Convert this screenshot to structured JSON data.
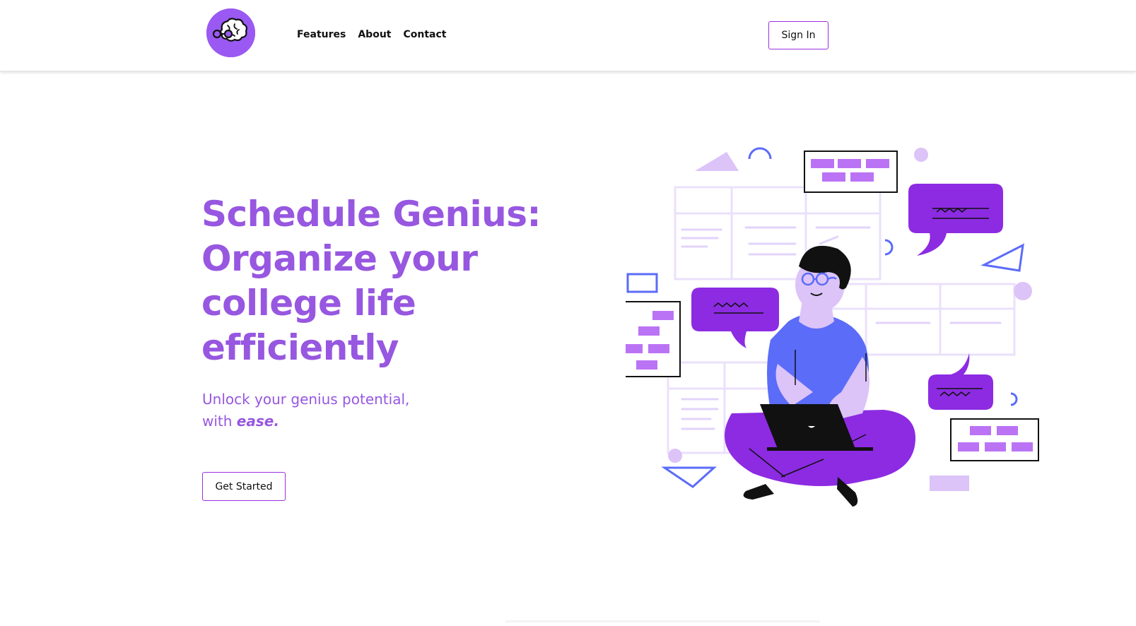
{
  "header": {
    "logo_icon": "brain-with-glasses-logo",
    "nav": [
      {
        "label": "Features"
      },
      {
        "label": "About"
      },
      {
        "label": "Contact"
      }
    ],
    "signin_label": "Sign In"
  },
  "hero": {
    "title_lines": [
      "Schedule Genius:",
      "Organize your",
      "college life",
      "efficiently"
    ],
    "subtitle_line1": "Unlock your genius potential,",
    "subtitle_line2_prefix": "with",
    "subtitle_emphasis": "ease.",
    "cta_label": "Get Started",
    "illustration": "person-with-laptop-schedule-illustration"
  },
  "colors": {
    "brand": "#9757e0",
    "accent": "#8c2be2",
    "light_purple": "#c8a5f5",
    "blue": "#5b6cf8"
  }
}
